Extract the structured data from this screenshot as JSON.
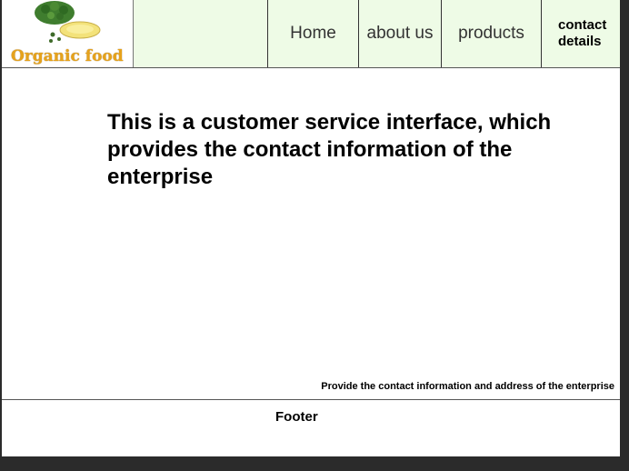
{
  "logo": {
    "text": "Organic food"
  },
  "nav": {
    "home": "Home",
    "about": "about us",
    "products": "products",
    "contact": "contact details"
  },
  "main": {
    "headline": "This is a customer service interface, which provides the contact information of the enterprise",
    "caption": "Provide the contact information and address of the enterprise"
  },
  "footer": {
    "label": "Footer"
  },
  "colors": {
    "nav_background": "#eefbe6",
    "logo_text": "#e6a21b",
    "frame": "#2b2b2b"
  }
}
